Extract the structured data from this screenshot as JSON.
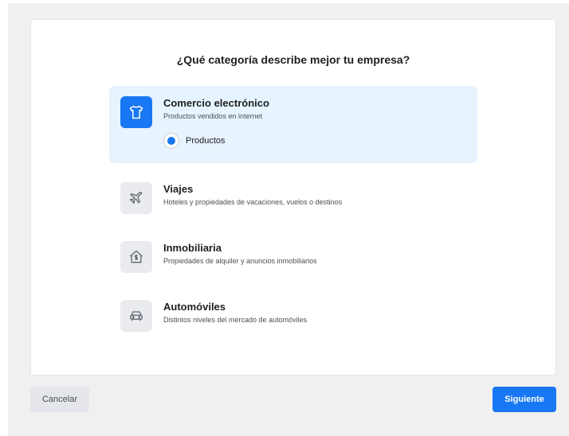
{
  "heading": "¿Qué categoría describe mejor tu empresa?",
  "options": [
    {
      "title": "Comercio electrónico",
      "description": "Productos vendidos en internet",
      "icon": "tshirt-icon",
      "selected": true,
      "sub_option": {
        "label": "Productos",
        "checked": true
      }
    },
    {
      "title": "Viajes",
      "description": "Hoteles y propiedades de vacaciones, vuelos o destinos",
      "icon": "airplane-icon",
      "selected": false
    },
    {
      "title": "Inmobiliaria",
      "description": "Propiedades de alquiler y anuncios inmobiliarios",
      "icon": "house-dollar-icon",
      "selected": false
    },
    {
      "title": "Automóviles",
      "description": "Distintos niveles del mercado de automóviles",
      "icon": "car-icon",
      "selected": false
    }
  ],
  "footer": {
    "cancel_label": "Cancelar",
    "next_label": "Siguiente"
  },
  "colors": {
    "accent": "#1877f2",
    "selected_bg": "#e7f3ff",
    "icon_bg": "#e9ebee"
  }
}
